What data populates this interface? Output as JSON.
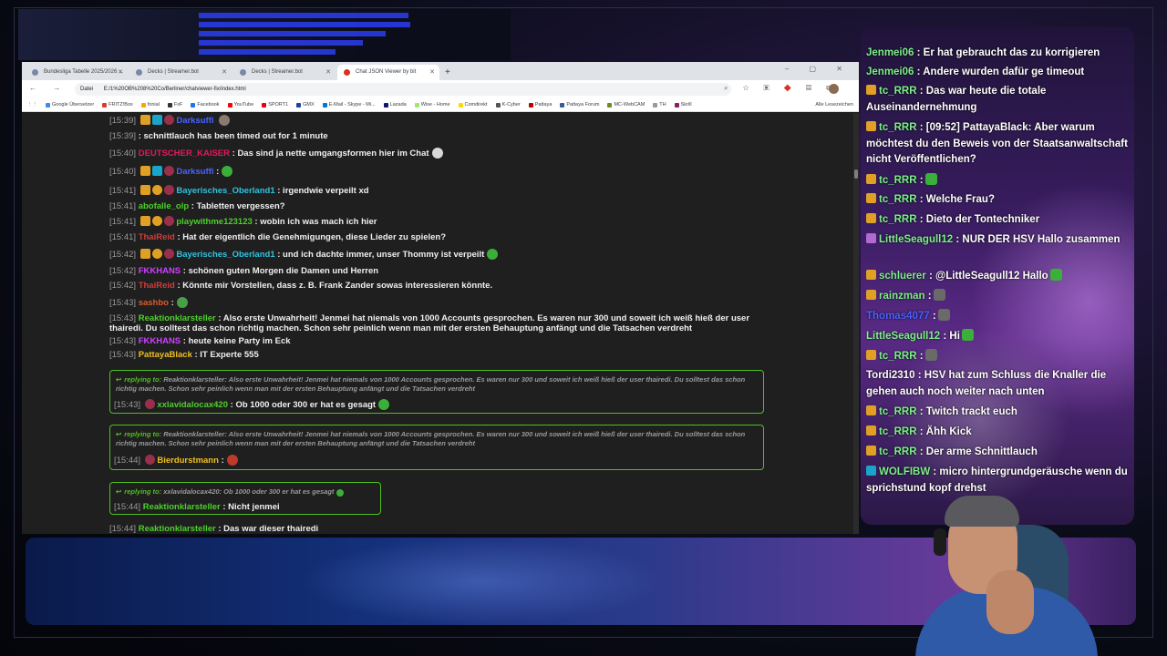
{
  "browser": {
    "tabs": [
      {
        "title": "Bundesliga Tabelle 2025/2026 ..."
      },
      {
        "title": "Decks | Streamer.bot"
      },
      {
        "title": "Decks | Streamer.bot"
      },
      {
        "title": "Chat JSON Viewer by bit"
      }
    ],
    "new_tab_label": "+",
    "window_controls": "– ▢ ✕",
    "nav_buttons": "← → ↻",
    "url_scheme": "Datei",
    "url": "E:/1%20OB%208%20Co/Berliner/chatviewer-fix/index.html",
    "bookmarks": [
      {
        "label": "Google Übersetzer",
        "color": "#4285f4"
      },
      {
        "label": "FRITZ!Box",
        "color": "#e03a2f"
      },
      {
        "label": "fonial",
        "color": "#f2a900"
      },
      {
        "label": "FxF",
        "color": "#333333"
      },
      {
        "label": "Facebook",
        "color": "#1877f2"
      },
      {
        "label": "YouTube",
        "color": "#ff0000"
      },
      {
        "label": "SPORT1",
        "color": "#e3001b"
      },
      {
        "label": "GMX",
        "color": "#1c449b"
      },
      {
        "label": "E-Mail - Skype - Mi...",
        "color": "#0078d4"
      },
      {
        "label": "Lazada",
        "color": "#0f146d"
      },
      {
        "label": "Wise - Home",
        "color": "#9fe870"
      },
      {
        "label": "Comdirekt",
        "color": "#ffd800"
      },
      {
        "label": "K-Cyber",
        "color": "#555555"
      },
      {
        "label": "Pattaya",
        "color": "#c00000"
      },
      {
        "label": "Pattaya Forum",
        "color": "#3b5998"
      },
      {
        "label": "MC-WebCAM",
        "color": "#6b8e23"
      },
      {
        "label": "TH",
        "color": "#999999"
      },
      {
        "label": "Skrill",
        "color": "#862165"
      }
    ],
    "bookmarks_more": "Alle Lesezeichen"
  },
  "chat_log": {
    "messages": [
      {
        "ts": "[15:39]",
        "user": "Darksuffi",
        "color": "#4a63ff",
        "text": ""
      },
      {
        "ts": "[15:39]",
        "user": "",
        "color": "#f0f0f0",
        "text": ": schnittlauch has been timed out for 1 minute"
      },
      {
        "ts": "[15:40]",
        "user": "DEUTSCHER_KAISER",
        "color": "#e4195d",
        "text": ": Das sind ja nette umgangsformen hier im Chat"
      },
      {
        "ts": "[15:40]",
        "user": "Darksuffi",
        "color": "#4a63ff",
        "text": ":"
      },
      {
        "ts": "[15:41]",
        "user": "Bayerisches_Oberland1",
        "color": "#2fc2e0",
        "text": ": irgendwie verpeilt xd"
      },
      {
        "ts": "[15:41]",
        "user": "abofalle_olp",
        "color": "#4cd02b",
        "text": ": Tabletten vergessen?"
      },
      {
        "ts": "[15:41]",
        "user": "playwithme123123",
        "color": "#4cd02b",
        "text": ": wobin ich was mach ich hier"
      },
      {
        "ts": "[15:41]",
        "user": "ThaiReid",
        "color": "#d23c3c",
        "text": ": Hat der eigentlich die Genehmigungen, diese Lieder zu spielen?"
      },
      {
        "ts": "[15:42]",
        "user": "Bayerisches_Oberland1",
        "color": "#2fc2e0",
        "text": ": und ich dachte immer, unser Thommy ist verpeilt"
      },
      {
        "ts": "[15:42]",
        "user": "FKKHANS",
        "color": "#ce42ff",
        "text": ": schönen guten Morgen die Damen und Herren"
      },
      {
        "ts": "[15:42]",
        "user": "ThaiReid",
        "color": "#d23c3c",
        "text": ": Könnte mir Vorstellen, dass z. B. Frank Zander sowas interessieren könnte."
      },
      {
        "ts": "[15:43]",
        "user": "sashbo",
        "color": "#e05a28",
        "text": ":"
      },
      {
        "ts": "[15:43]",
        "user": "FKKHANS",
        "color": "#ce42ff",
        "text": ": heute keine Party im Eck"
      },
      {
        "ts": "[15:43]",
        "user": "PattayaBlack",
        "color": "#f0c020",
        "text": ": IT Experte 555"
      }
    ],
    "long_message": {
      "ts": "[15:43]",
      "user": "Reaktionklarsteller",
      "color": "#4cd02b",
      "text": ": Also erste Unwahrheit! Jenmei hat niemals von 1000 Accounts gesprochen. Es waren nur 300 und soweit ich weiß hieß der user thairedi. Du solltest das schon richtig machen. Schon sehr peinlich wenn man mit der ersten Behauptung anfängt und die Tatsachen verdreht"
    },
    "replies": [
      {
        "label": "replying to:",
        "quote": "Reaktionklarsteller: Also erste Unwahrheit! Jenmei hat niemals von 1000 Accounts gesprochen. Es waren nur 300 und soweit ich weiß hieß der user thairedi. Du solltest das schon richtig machen. Schon sehr peinlich wenn man mit der ersten Behauptung anfängt und die Tatsachen verdreht",
        "ts": "[15:43]",
        "user": "xxlavidalocax420",
        "color": "#4cd02b",
        "text": ": Ob 1000 oder 300 er hat es gesagt"
      },
      {
        "label": "replying to:",
        "quote": "Reaktionklarsteller: Also erste Unwahrheit! Jenmei hat niemals von 1000 Accounts gesprochen. Es waren nur 300 und soweit ich weiß hieß der user thairedi. Du solltest das schon richtig machen. Schon sehr peinlich wenn man mit der ersten Behauptung anfängt und die Tatsachen verdreht",
        "ts": "[15:44]",
        "user": "Bierdurstmann",
        "color": "#f0c020",
        "text": ":"
      },
      {
        "label": "replying to:",
        "quote": "xxlavidalocax420: Ob 1000 oder 300 er hat es gesagt",
        "ts": "[15:44]",
        "user": "Reaktionklarsteller",
        "color": "#4cd02b",
        "text": ": Nicht jenmei"
      }
    ],
    "last_partial": {
      "ts": "[15:44]",
      "user": "Reaktionklarsteller",
      "color": "#4cd02b",
      "text": ": Das war dieser thairedi"
    }
  },
  "chat_overlay": {
    "messages": [
      {
        "user": "Jenmei06",
        "color": "#7cf08a",
        "text": ": Er hat gebraucht das zu korrigieren"
      },
      {
        "user": "Jenmei06",
        "color": "#7cf08a",
        "text": ": Andere wurden dafür ge timeout"
      },
      {
        "user": "tc_RRR",
        "color": "#7cf08a",
        "text": ": Das war heute die totale Auseinandernehmung"
      },
      {
        "user": "tc_RRR",
        "color": "#7cf08a",
        "text": ": [09:52] PattayaBlack: Aber warum möchtest du den Beweis von der Staatsanwaltschaft nicht Veröffentlichen?"
      },
      {
        "user": "tc_RRR",
        "color": "#7cf08a",
        "text": ":"
      },
      {
        "user": "tc_RRR",
        "color": "#7cf08a",
        "text": ": Welche Frau?"
      },
      {
        "user": "tc_RRR",
        "color": "#7cf08a",
        "text": ": Dieto der Tontechniker"
      },
      {
        "user": "LittleSeagull12",
        "color": "#7cf08a",
        "text": ": NUR DER HSV Hallo zusammen"
      },
      {
        "user": "schluerer",
        "color": "#7cf08a",
        "text": ": @LittleSeagull12 Hallo"
      },
      {
        "user": "rainzman",
        "color": "#7cf08a",
        "text": ":"
      },
      {
        "user": "Thomas4077",
        "color": "#4a63ff",
        "text": ":"
      },
      {
        "user": "LittleSeagull12",
        "color": "#7cf08a",
        "text": ": Hi"
      },
      {
        "user": "tc_RRR",
        "color": "#7cf08a",
        "text": ":"
      },
      {
        "user": "Tordi2310",
        "color": "#ffffff",
        "text": ": HSV hat zum Schluss die Knaller die gehen auch noch weiter nach unten"
      },
      {
        "user": "tc_RRR",
        "color": "#7cf08a",
        "text": ": Twitch trackt euch"
      },
      {
        "user": "tc_RRR",
        "color": "#7cf08a",
        "text": ": Ähh Kick"
      },
      {
        "user": "tc_RRR",
        "color": "#7cf08a",
        "text": ": Der arme Schnittlauch"
      },
      {
        "user": "WOLFIBW",
        "color": "#7cf08a",
        "text": ": micro hintergrundgeräusche wenn du sprichstund kopf drehst"
      }
    ]
  },
  "colors": {
    "reply_border": "#50c01f",
    "page_bg": "#1f1f1f",
    "chat_overlay_bg": "#3a1d62",
    "bottom_panel": "#14307a"
  }
}
